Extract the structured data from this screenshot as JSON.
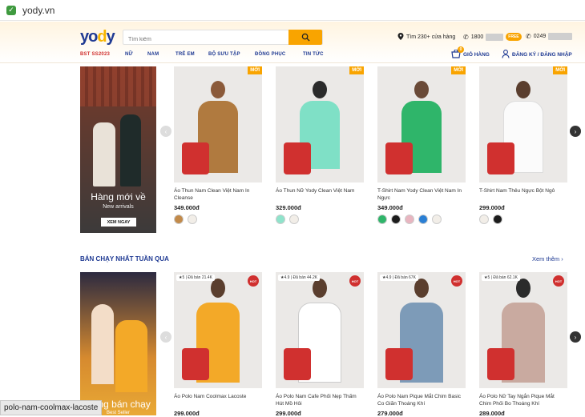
{
  "browser": {
    "url": "yody.vn",
    "status_tooltip": "polo-nam-coolmax-lacoste"
  },
  "header": {
    "logo_prefix": "yo",
    "logo_accent": "d",
    "logo_suffix": "y",
    "search_placeholder": "Tìm kiếm",
    "stores": "Tìm 230+ cửa hàng",
    "phone1": "1800",
    "free_badge": "FREE",
    "phone2": "0249",
    "cart_label": "GIỎ HÀNG",
    "cart_count": "0",
    "account_label": "ĐĂNG KÝ / ĐĂNG NHẬP",
    "nav": [
      "BST SS2023",
      "NỮ",
      "NAM",
      "TRẺ EM",
      "BỘ SƯU TẬP",
      "ĐỒNG PHỤC",
      "TIN TỨC"
    ]
  },
  "banner_top": {
    "title": "Hàng mới về",
    "subtitle": "New arrivals",
    "button": "XEM NGAY"
  },
  "banner_bottom": {
    "title": "Hàng bán chạy",
    "subtitle": "Best Seller"
  },
  "new_products": [
    {
      "name": "Áo Thun Nam Clean Việt Nam In Cleanse",
      "price": "349.000đ",
      "badge": "MỚI",
      "color": "#b07a3f",
      "swatches": [
        "#c28a4a",
        "#f2eee8"
      ]
    },
    {
      "name": "Áo Thun Nữ Yody Clean Việt Nam",
      "price": "329.000đ",
      "badge": "MỚI",
      "color": "#7fe0c6",
      "swatches": [
        "#8fe3cb",
        "#f2eee8"
      ]
    },
    {
      "name": "T-Shirt Nam Yody Clean Việt Nam In Ngực",
      "price": "349.000đ",
      "badge": "MỚI",
      "color": "#2fb56a",
      "swatches": [
        "#2fb56a",
        "#1c1c1c",
        "#e8b5c0",
        "#2a7fd4",
        "#f2eee8"
      ]
    },
    {
      "name": "T-Shirt Nam Thêu Ngực Bột Ngô",
      "price": "299.000đ",
      "badge": "MỚI",
      "color": "#f5f5f5",
      "swatches": [
        "#f2eee8",
        "#1c1c1c"
      ]
    }
  ],
  "bestseller_section": {
    "title": "BÁN CHẠY NHẤT TUẦN QUA",
    "see_more": "Xem thêm"
  },
  "best_products": [
    {
      "name": "Áo Polo Nam Coolmax Lacoste",
      "price": "299.000đ",
      "sold": "★5 | Đã bán 21.4K",
      "hot": "HOT",
      "color": "#f3a928"
    },
    {
      "name": "Áo Polo Nam Cafe Phối Nẹp Thấm Hút Mồ Hôi",
      "price": "299.000đ",
      "sold": "★4.9 | Đã bán 44.2K",
      "hot": "HOT",
      "color": "#ffffff"
    },
    {
      "name": "Áo Polo Nam Pique Mắt Chim Basic Co Giãn Thoáng Khí",
      "price": "279.000đ",
      "sold": "★4.9 | Đã bán 67K",
      "hot": "HOT",
      "color": "#7d9bb8"
    },
    {
      "name": "Áo Polo Nữ Tay Ngắn Pique Mắt Chim Phối Bo Thoáng Khí",
      "price": "289.000đ",
      "sold": "★5 | Đã bán 62.1K",
      "hot": "HOT",
      "color": "#c9aaa0"
    }
  ]
}
